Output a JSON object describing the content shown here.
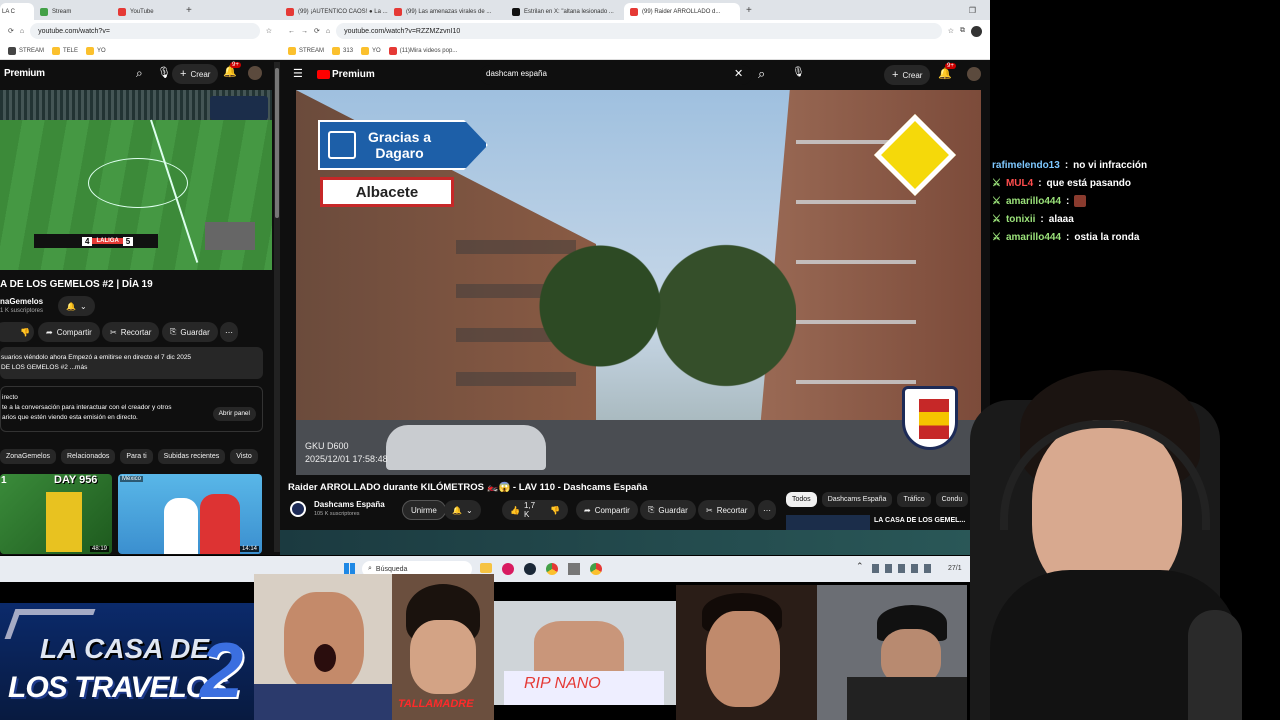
{
  "left_browser": {
    "tabs": [
      {
        "label": "LA C",
        "color": "#e53935",
        "active": true
      },
      {
        "label": "Stream",
        "color": "#43a047"
      },
      {
        "label": "YouTube",
        "color": "#e53935"
      }
    ],
    "url": "youtube.com/watch?v=",
    "bookmarks": [
      "STREAM",
      "TELE",
      "YO"
    ],
    "brand": "Premium",
    "create_label": "Crear",
    "notif_count": "9+",
    "video_title": "A DE LOS GEMELOS #2 | DÍA 19",
    "channel": "naGemelos",
    "subs": "1 K suscriptores",
    "actions": {
      "share": "Compartir",
      "clip": "Recortar",
      "save": "Guardar"
    },
    "live_desc_1": "suarios viéndolo ahora  Empezó a emitirse en directo el 7 dic 2025",
    "live_desc_2": "DE LOS GEMELOS #2 ...más",
    "chat_title": "irecto",
    "chat_desc_1": "te a la conversación para interactuar con el creador y otros",
    "chat_desc_2": "arios que estén viendo esta emisión en directo.",
    "open_panel": "Abrir panel",
    "chips": [
      "ZonaGemelos",
      "Relacionados",
      "Para ti",
      "Subidas recientes",
      "Visto"
    ],
    "scoreboard": {
      "home": "4",
      "away": "5",
      "league": "LALIGA"
    },
    "thumbs": [
      {
        "label": "DAY 956",
        "duration": "48:19",
        "rank": "1"
      },
      {
        "label": "México",
        "duration": "14:14"
      }
    ]
  },
  "right_browser": {
    "tabs": [
      {
        "label": "(99) ¡AUTENTICO CAOS! ● La ...",
        "color": "#e53935"
      },
      {
        "label": "(99) Las amenazas virales de ...",
        "color": "#e53935"
      },
      {
        "label": "Estrilan en X: \"altana lesionado ...",
        "color": "#111111"
      },
      {
        "label": "(99) Raider ARROLLADO d...",
        "color": "#e53935",
        "active": true
      }
    ],
    "url": "youtube.com/watch?v=RZZMZzvnI10",
    "bookmarks": [
      "STREAM",
      "313",
      "YO",
      "(11)Mira videos pop..."
    ],
    "brand": "Premium",
    "search_value": "dashcam españa",
    "create_label": "Crear",
    "notif_count": "9+",
    "video": {
      "sign_line1": "Gracias a",
      "sign_line2": "Dagaro",
      "city": "Albacete",
      "gku": "GKU  D600",
      "timestamp": "2025/12/01  17:58:48"
    },
    "video_title": "Raider ARROLLADO durante KILÓMETROS 🏍️😱 - LAV 110 - Dashcams España",
    "channel": "Dashcams España",
    "subs": "105 K suscriptores",
    "join": "Unirme",
    "likes": "1,7 K",
    "actions": {
      "share": "Compartir",
      "save": "Guardar",
      "clip": "Recortar"
    },
    "chips": [
      "Todos",
      "Dashcams España",
      "Tráfico",
      "Condu"
    ],
    "side_video_title": "LA CASA DE LOS GEMEL..."
  },
  "chat": [
    {
      "user": "rafimelendo13",
      "message": "no vi infracción",
      "user_color": "#7ec8ff",
      "badge": false
    },
    {
      "user": "MUL4",
      "message": "que está pasando",
      "user_color": "#ff4d4d",
      "badge": true
    },
    {
      "user": "amarillo444",
      "message": "",
      "user_color": "#9be27a",
      "badge": true,
      "emote": true
    },
    {
      "user": "tonixii",
      "message": "alaaa",
      "user_color": "#9be27a",
      "badge": true
    },
    {
      "user": "amarillo444",
      "message": "ostia la ronda",
      "user_color": "#9be27a",
      "badge": true
    }
  ],
  "taskbar": {
    "search": "Búsqueda",
    "time": "27/1"
  },
  "overlay": {
    "logo_line1": "LA CASA DE",
    "logo_line2": "LOS TRAVELOS",
    "logo_number": "2",
    "tallamadre": "TALLAMADRE",
    "rip": "RIP NANO"
  },
  "colors": {
    "yt_red": "#ff0000",
    "sign_blue": "#1d5fa8",
    "dark": "#0f0f0f"
  }
}
